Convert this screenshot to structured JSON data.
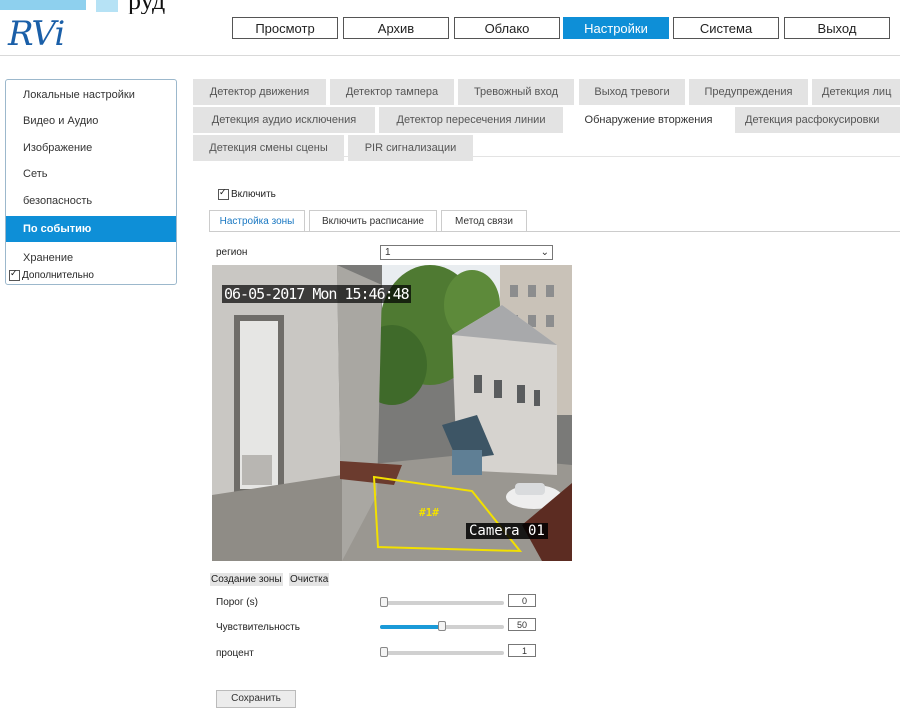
{
  "top_fragment": {
    "text": "руд"
  },
  "logo": {
    "text": "RVi"
  },
  "topnav": [
    "Просмотр",
    "Архив",
    "Облако",
    "Настройки",
    "Система",
    "Выход"
  ],
  "topnav_active": "Настройки",
  "sidebar": {
    "items": [
      "Локальные настройки",
      "Видео и Аудио",
      "Изображение",
      "Сеть",
      "безопасность",
      "По событию",
      "Хранение"
    ],
    "active": "По событию",
    "advanced_checkbox": {
      "label": "Дополнительно",
      "checked": true
    }
  },
  "event_tabs": {
    "row1": [
      "Детектор движения",
      "Детектор тампера",
      "Тревожный вход",
      "Выход тревоги",
      "Предупреждения",
      "Детекция лиц"
    ],
    "row2": [
      "Детекция аудио исключения",
      "Детектор пересечения линии",
      "Обнаружение вторжения",
      "Детекция расфокусировки"
    ],
    "row3": [
      "Детекция смены сцены",
      "PIR сигнализации"
    ],
    "active": "Обнаружение вторжения"
  },
  "enable": {
    "label": "Включить",
    "checked": true
  },
  "subtabs": {
    "items": [
      "Настройка зоны",
      "Включить расписание",
      "Метод связи"
    ],
    "active": "Настройка зоны"
  },
  "region": {
    "label": "регион",
    "value": "1"
  },
  "video": {
    "timestamp": "06-05-2017 Mon 15:46:48",
    "camera_label": "Camera 01",
    "zone_label": "#1#"
  },
  "zone_buttons": {
    "create": "Создание зоны",
    "clear": "Очистка"
  },
  "sliders": [
    {
      "label": "Порог (s)",
      "value": "0",
      "level": 0.0
    },
    {
      "label": "Чувствительность",
      "value": "50",
      "level": 0.5
    },
    {
      "label": "процент",
      "value": "1",
      "level": 0.0
    }
  ],
  "save_label": "Сохранить",
  "colors": {
    "accent": "#0e8fd7",
    "zone_outline": "#f2e000"
  }
}
